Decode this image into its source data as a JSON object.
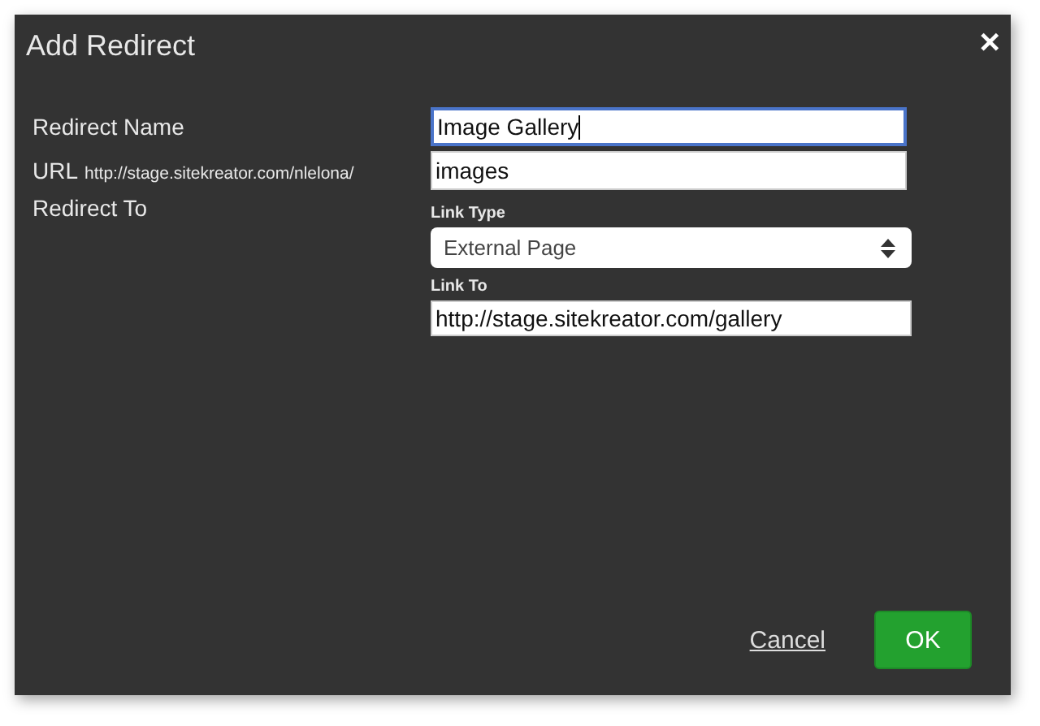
{
  "dialog": {
    "title": "Add Redirect",
    "close": "✕"
  },
  "fields": [
    {
      "kind": "input",
      "label": "Redirect Name",
      "value": "Image Gallery",
      "focused": true
    },
    {
      "kind": "input",
      "label": "URL",
      "prefix": "http://stage.sitekreator.com/nlelona/",
      "value": "images",
      "focused": false
    }
  ],
  "redirect_to": {
    "label": "Redirect To",
    "link_type": {
      "label": "Link Type",
      "value": "External Page"
    },
    "link_to": {
      "label": "Link To",
      "value": "http://stage.sitekreator.com/gallery",
      "focused": false
    }
  },
  "buttons": {
    "cancel": "Cancel",
    "ok": "OK"
  }
}
